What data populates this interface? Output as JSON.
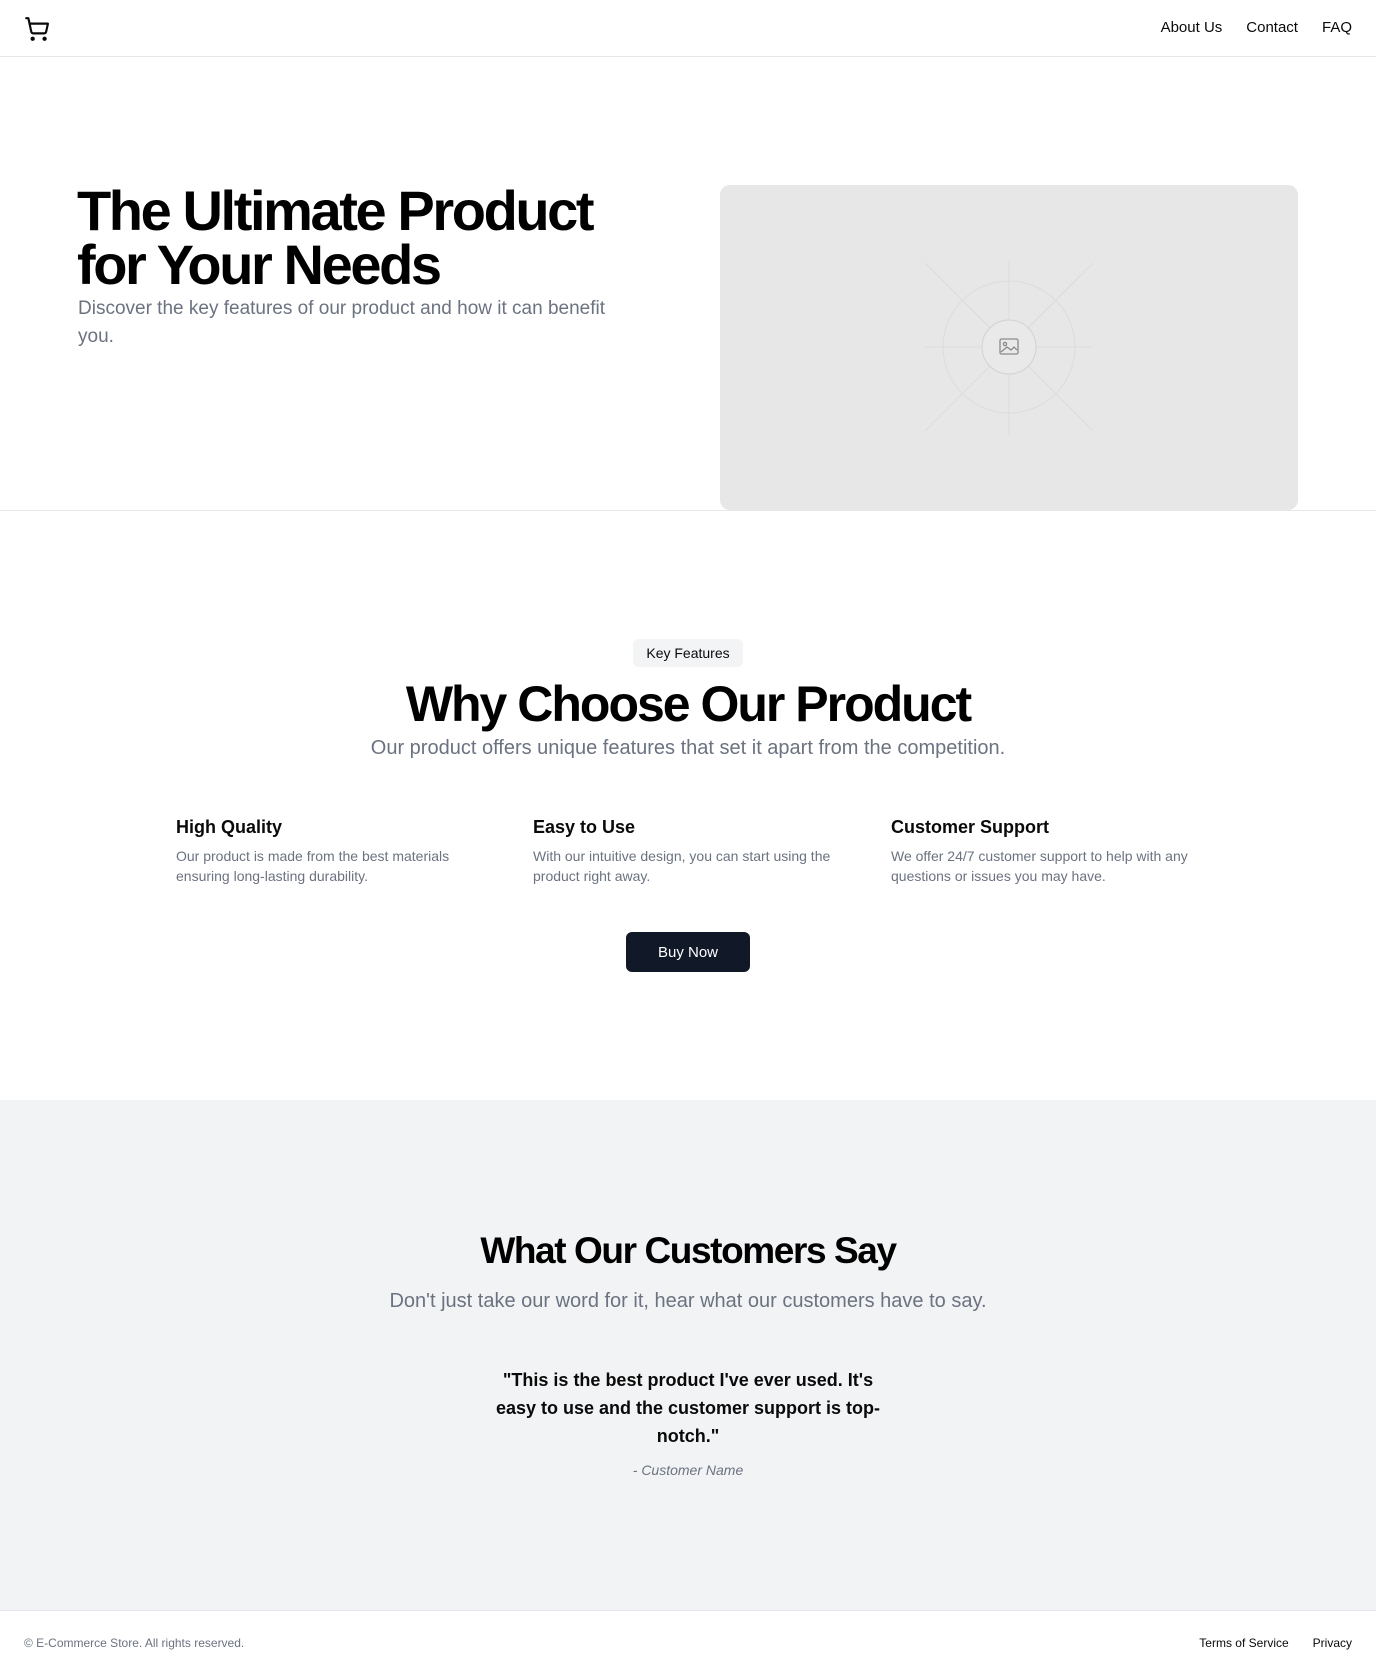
{
  "header": {
    "cart_icon": "shopping-cart-icon",
    "nav": [
      {
        "label": "About Us"
      },
      {
        "label": "Contact"
      },
      {
        "label": "FAQ"
      }
    ]
  },
  "hero": {
    "title": "The Ultimate Product for Your Needs",
    "subtitle": "Discover the key features of our product and how it can benefit you.",
    "image_icon": "image-placeholder-icon"
  },
  "features": {
    "badge": "Key Features",
    "title": "Why Choose Our Product",
    "subtitle": "Our product offers unique features that set it apart from the competition.",
    "items": [
      {
        "title": "High Quality",
        "text": "Our product is made from the best materials ensuring long-lasting durability."
      },
      {
        "title": "Easy to Use",
        "text": "With our intuitive design, you can start using the product right away."
      },
      {
        "title": "Customer Support",
        "text": "We offer 24/7 customer support to help with any questions or issues you may have."
      }
    ],
    "cta_label": "Buy Now"
  },
  "testimonials": {
    "title": "What Our Customers Say",
    "subtitle": "Don't just take our word for it, hear what our customers have to say.",
    "quote": "\"This is the best product I've ever used. It's easy to use and the customer support is top-notch.\"",
    "author": "- Customer Name"
  },
  "footer": {
    "copyright": "© E-Commerce Store. All rights reserved.",
    "links": [
      {
        "label": "Terms of Service"
      },
      {
        "label": "Privacy"
      }
    ]
  },
  "colors": {
    "primary_button": "#111827",
    "muted_text": "#6b7280",
    "testimonial_bg": "#f2f3f5",
    "placeholder_bg": "#e7e7e7"
  }
}
